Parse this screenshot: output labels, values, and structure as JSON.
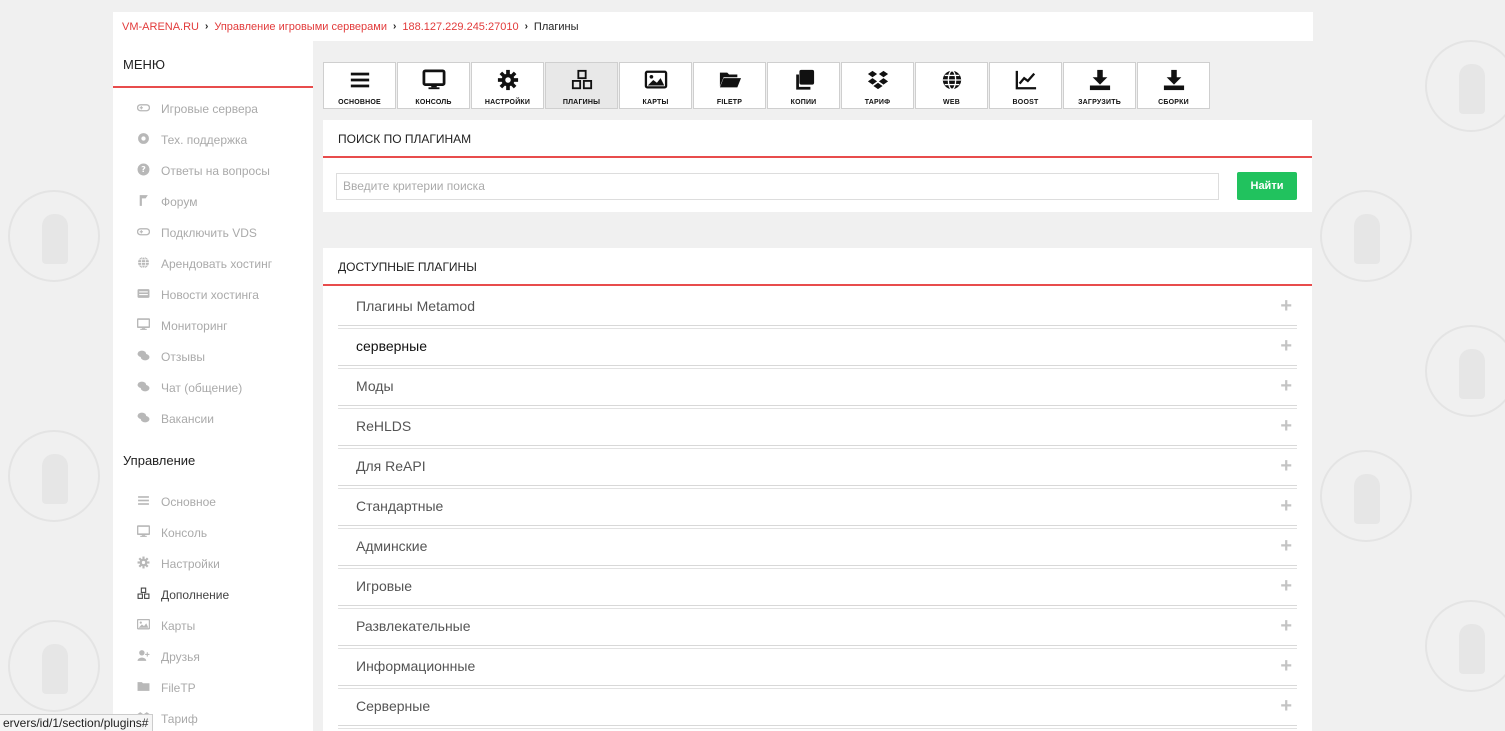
{
  "breadcrumb": [
    {
      "label": "VM-ARENA.RU"
    },
    {
      "label": "Управление игровыми серверами"
    },
    {
      "label": "188.127.229.245:27010"
    },
    {
      "label": "Плагины"
    }
  ],
  "sidebar": {
    "menu_title": "МЕНЮ",
    "menu_items": [
      {
        "label": "Игровые сервера",
        "icon": "gamepad-icon"
      },
      {
        "label": "Тех. поддержка",
        "icon": "lifebuoy-icon"
      },
      {
        "label": "Ответы на вопросы",
        "icon": "question-icon"
      },
      {
        "label": "Форум",
        "icon": "forum-icon"
      },
      {
        "label": "Подключить VDS",
        "icon": "gamepad-icon"
      },
      {
        "label": "Арендовать хостинг",
        "icon": "globe-icon"
      },
      {
        "label": "Новости хостинга",
        "icon": "newspaper-icon"
      },
      {
        "label": "Мониторинг",
        "icon": "monitor-icon"
      },
      {
        "label": "Отзывы",
        "icon": "comments-icon"
      },
      {
        "label": "Чат (общение)",
        "icon": "comments-icon"
      },
      {
        "label": "Вакансии",
        "icon": "comments-icon"
      }
    ],
    "manage_title": "Управление",
    "manage_items": [
      {
        "label": "Основное",
        "icon": "bars-icon"
      },
      {
        "label": "Консоль",
        "icon": "monitor-icon"
      },
      {
        "label": "Настройки",
        "icon": "gear-icon"
      },
      {
        "label": "Дополнение",
        "icon": "cubes-icon",
        "active": true
      },
      {
        "label": "Карты",
        "icon": "image-icon"
      },
      {
        "label": "Друзья",
        "icon": "user-plus-icon"
      },
      {
        "label": "FileTP",
        "icon": "folder-icon"
      },
      {
        "label": "Тариф",
        "icon": "dropbox-icon"
      }
    ]
  },
  "toolbar": [
    {
      "label": "ОСНОВНОЕ",
      "icon": "bars-icon"
    },
    {
      "label": "КОНСОЛЬ",
      "icon": "monitor-icon"
    },
    {
      "label": "НАСТРОЙКИ",
      "icon": "gear-icon"
    },
    {
      "label": "ПЛАГИНЫ",
      "icon": "cubes-icon",
      "active": true
    },
    {
      "label": "КАРТЫ",
      "icon": "image-icon"
    },
    {
      "label": "FILETP",
      "icon": "folder-open-icon"
    },
    {
      "label": "КОПИИ",
      "icon": "copy-icon"
    },
    {
      "label": "ТАРИФ",
      "icon": "dropbox-icon"
    },
    {
      "label": "WEB",
      "icon": "globe-icon"
    },
    {
      "label": "BOOST",
      "icon": "chart-line-icon"
    },
    {
      "label": "ЗАГРУЗИТЬ",
      "icon": "download-icon"
    },
    {
      "label": "СБОРКИ",
      "icon": "download-icon"
    }
  ],
  "search": {
    "title": "ПОИСК ПО ПЛАГИНАМ",
    "placeholder": "Введите критерии поиска",
    "value": "",
    "button": "Найти",
    "button_color": "#21c25e"
  },
  "plugins": {
    "title": "ДОСТУПНЫЕ ПЛАГИНЫ",
    "expand_symbol": "+",
    "items": [
      {
        "label": "Плагины Metamod"
      },
      {
        "label": "серверные",
        "dark": true
      },
      {
        "label": "Моды"
      },
      {
        "label": "ReHLDS"
      },
      {
        "label": "Для ReAPI"
      },
      {
        "label": "Стандартные"
      },
      {
        "label": "Админские"
      },
      {
        "label": "Игровые"
      },
      {
        "label": "Развлекательные"
      },
      {
        "label": "Информационные"
      },
      {
        "label": "Серверные"
      }
    ]
  },
  "status_url": "ervers/id/1/section/plugins#",
  "colors": {
    "accent": "#e84c4c",
    "link": "#e23b3b"
  }
}
